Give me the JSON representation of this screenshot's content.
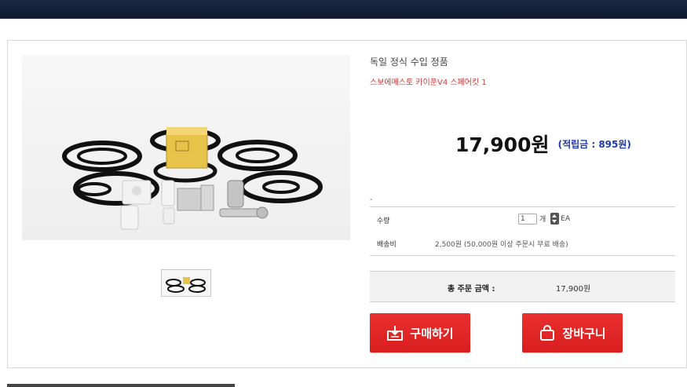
{
  "product": {
    "subtitle": "독일 정식 수입 정품",
    "name": "스보에메스토 카이푼V4 스페어킷 1",
    "price": "17,900원",
    "points": "(적립금 : 895원)",
    "dash": "-"
  },
  "options": {
    "qty_label": "수량",
    "qty_value": "1",
    "qty_unit": "개",
    "qty_ea": "EA",
    "shipping_label": "배송비",
    "shipping_value": "2,500원 (50,000원 이상 주문시 무료 배송)"
  },
  "total": {
    "label": "총 주문 금액 :",
    "value": "17,900원"
  },
  "buttons": {
    "buy": "구매하기",
    "cart": "장바구니"
  },
  "icons": {
    "buy_icon": "download-box-icon",
    "cart_icon": "shopping-bag-icon"
  },
  "colors": {
    "accent_red": "#d81e1e",
    "points_blue": "#1e3aa8",
    "name_red": "#d23a3a",
    "topbar": "#0f1a30"
  }
}
